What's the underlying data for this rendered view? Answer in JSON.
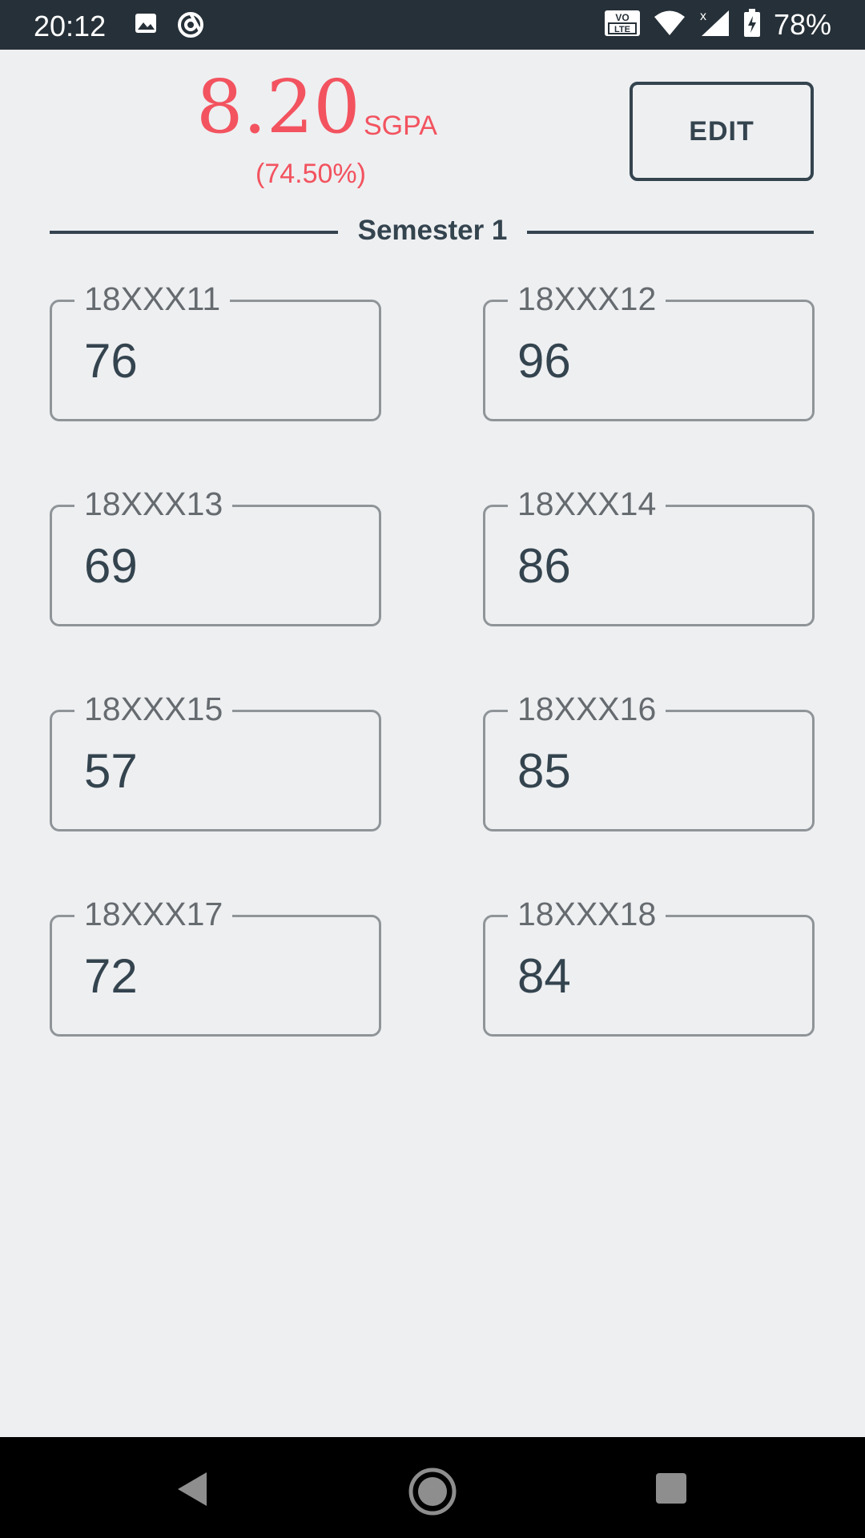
{
  "status_bar": {
    "time": "20:12",
    "volte_label": "VO\nLTE",
    "battery": "78%"
  },
  "header": {
    "sgpa_value": "8.20",
    "sgpa_unit": "SGPA",
    "percentage": "(74.50%)",
    "edit_label": "EDIT",
    "accent_color": "#f2535f"
  },
  "semester": {
    "title": "Semester 1",
    "subjects": [
      {
        "code": "18XXX11",
        "marks": "76"
      },
      {
        "code": "18XXX12",
        "marks": "96"
      },
      {
        "code": "18XXX13",
        "marks": "69"
      },
      {
        "code": "18XXX14",
        "marks": "86"
      },
      {
        "code": "18XXX15",
        "marks": "57"
      },
      {
        "code": "18XXX16",
        "marks": "85"
      },
      {
        "code": "18XXX17",
        "marks": "72"
      },
      {
        "code": "18XXX18",
        "marks": "84"
      }
    ]
  },
  "nav": {
    "icons": [
      "back-icon",
      "home-icon",
      "recents-icon"
    ]
  }
}
